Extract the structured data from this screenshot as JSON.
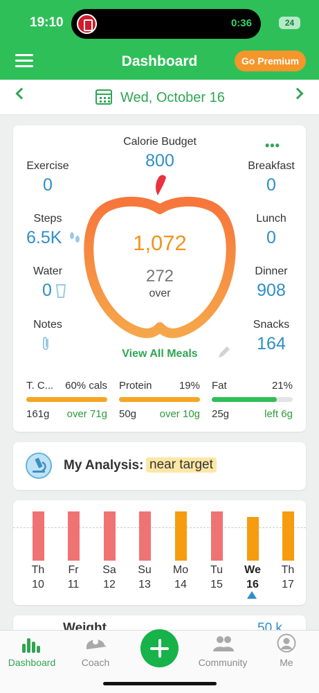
{
  "status": {
    "time": "19:10",
    "timer": "0:36",
    "battery": "24"
  },
  "header": {
    "title": "Dashboard",
    "premium_label": "Go Premium"
  },
  "datebar": {
    "date": "Wed, October 16"
  },
  "calories": {
    "budget_label": "Calorie Budget",
    "budget": "800",
    "consumed": "1,072",
    "over_amount": "272",
    "over_label": "over",
    "exercise_label": "Exercise",
    "exercise": "0",
    "steps_label": "Steps",
    "steps": "6.5K",
    "water_label": "Water",
    "water": "0",
    "notes_label": "Notes",
    "breakfast_label": "Breakfast",
    "breakfast": "0",
    "lunch_label": "Lunch",
    "lunch": "0",
    "dinner_label": "Dinner",
    "dinner": "908",
    "snacks_label": "Snacks",
    "snacks": "164",
    "view_all": "View All Meals"
  },
  "macros": [
    {
      "name": "T. C...",
      "pct": "60% cals",
      "grams": "161g",
      "status": "over 71g",
      "fill": 1.0,
      "color": "#f6a623"
    },
    {
      "name": "Protein",
      "pct": "19%",
      "grams": "50g",
      "status": "over 10g",
      "fill": 1.0,
      "color": "#f6a623"
    },
    {
      "name": "Fat",
      "pct": "21%",
      "grams": "25g",
      "status": "left 6g",
      "fill": 0.8,
      "color": "#2fbf59"
    }
  ],
  "analysis": {
    "title": "My Analysis:",
    "badge": "near target"
  },
  "week": [
    {
      "day": "Th",
      "date": "10",
      "status": "over",
      "color": "#f07373"
    },
    {
      "day": "Fr",
      "date": "11",
      "status": "over",
      "color": "#f07373"
    },
    {
      "day": "Sa",
      "date": "12",
      "status": "over",
      "color": "#f07373"
    },
    {
      "day": "Su",
      "date": "13",
      "status": "over",
      "color": "#f07373"
    },
    {
      "day": "Mo",
      "date": "14",
      "status": "near",
      "color": "#f59c0f"
    },
    {
      "day": "Tu",
      "date": "15",
      "status": "over",
      "color": "#f07373"
    },
    {
      "day": "We",
      "date": "16",
      "status": "near",
      "color": "#f59c0f",
      "selected": true
    },
    {
      "day": "Th",
      "date": "17",
      "status": "near",
      "color": "#f59c0f"
    }
  ],
  "peek": {
    "title": "Weight",
    "value": "50 k"
  },
  "tabbar": {
    "dashboard": "Dashboard",
    "coach": "Coach",
    "community": "Community",
    "me": "Me"
  },
  "colors": {
    "brand_green": "#2fbf59",
    "accent_orange": "#f4962a",
    "value_blue": "#2f8ec7"
  }
}
